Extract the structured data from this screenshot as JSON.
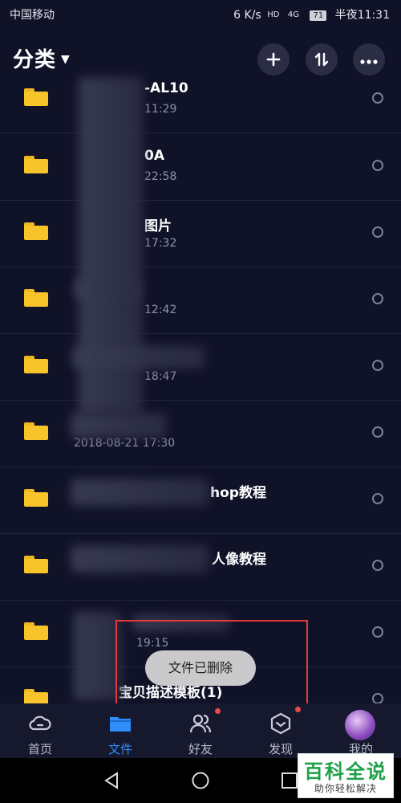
{
  "status": {
    "carrier": "中国移动",
    "speed": "6 K/s",
    "hd": "HD",
    "network": "4G",
    "battery": "71",
    "time": "半夜11:31"
  },
  "header": {
    "title": "分类",
    "add_icon": "plus-icon",
    "sort_icon": "sort-icon",
    "more_icon": "more-icon"
  },
  "files": [
    {
      "name": "-AL10",
      "date": "11:29"
    },
    {
      "name": "0A",
      "date": "22:58"
    },
    {
      "name": "图片",
      "date": "17:32"
    },
    {
      "name": "",
      "date": "12:42"
    },
    {
      "name": "",
      "date": "18:47"
    },
    {
      "name": "",
      "date": "2018-08-21  17:30"
    },
    {
      "name": "hop教程",
      "date": ""
    },
    {
      "name": "人像教程",
      "date": ""
    },
    {
      "name": "",
      "date": "19:15"
    },
    {
      "name": "宝贝描述模板(1)",
      "date": ""
    }
  ],
  "toast": "文件已删除",
  "tabs": [
    {
      "label": "首页",
      "icon": "cloud-icon"
    },
    {
      "label": "文件",
      "icon": "folder-icon"
    },
    {
      "label": "好友",
      "icon": "friends-icon"
    },
    {
      "label": "发现",
      "icon": "discover-icon"
    },
    {
      "label": "我的",
      "icon": "avatar-icon"
    }
  ],
  "watermark": {
    "title": "百科全说",
    "subtitle": "助你轻松解决"
  },
  "colors": {
    "accent": "#2f8dfa",
    "folder": "#f7c52a",
    "background": "#101228",
    "highlight_box": "#e53a3a"
  }
}
